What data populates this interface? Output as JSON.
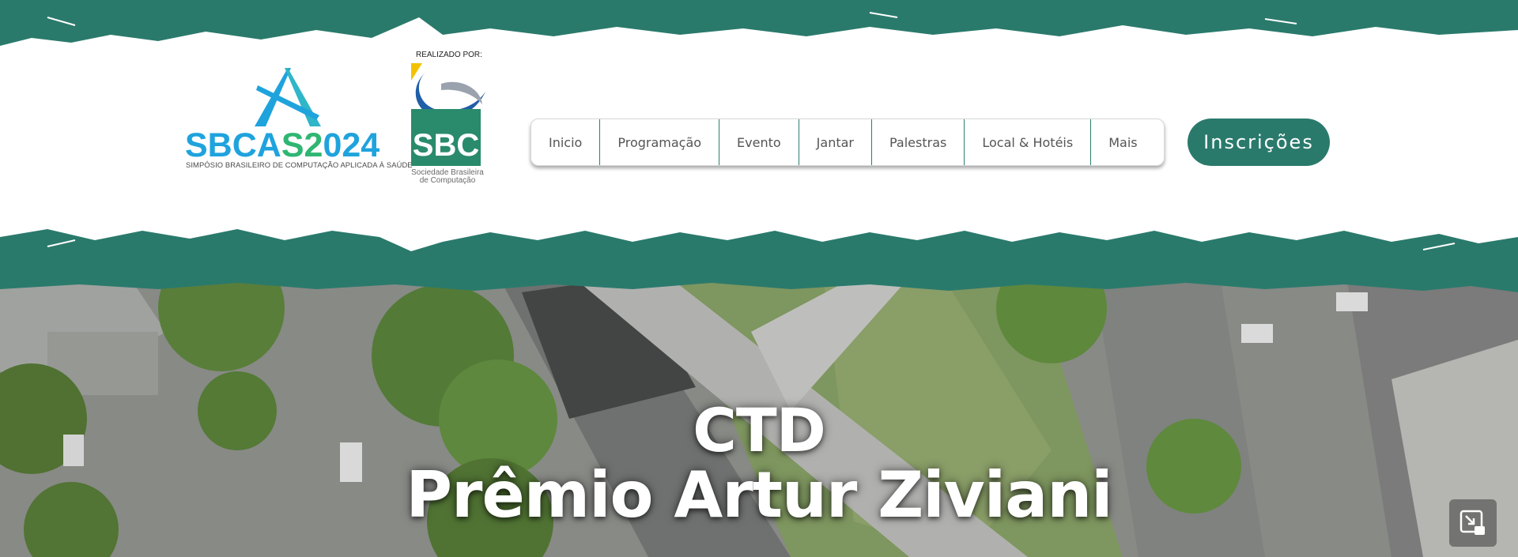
{
  "header": {
    "brand_colors": {
      "teal": "#2a7a6c",
      "white": "#ffffff"
    },
    "logo_sbcas": {
      "name_part1": "SBCA",
      "name_part2": "S2",
      "name_part3": "024",
      "subtitle": "SIMPÓSIO BRASILEIRO DE COMPUTAÇÃO APLICADA À SAÚDE"
    },
    "logo_sbc": {
      "realizado": "REALIZADO POR:",
      "letters": "SBC",
      "caption": "Sociedade Brasileira\nde Computação"
    }
  },
  "nav": {
    "items": [
      {
        "label": "Inicio"
      },
      {
        "label": "Programação"
      },
      {
        "label": "Evento"
      },
      {
        "label": "Jantar"
      },
      {
        "label": "Palestras"
      },
      {
        "label": "Local & Hotéis"
      },
      {
        "label": "Mais"
      }
    ]
  },
  "cta": {
    "label": "Inscrições"
  },
  "hero": {
    "line1": "CTD",
    "line2": "Prêmio Artur Ziviani"
  },
  "icons": {
    "expand": "expand-icon"
  }
}
